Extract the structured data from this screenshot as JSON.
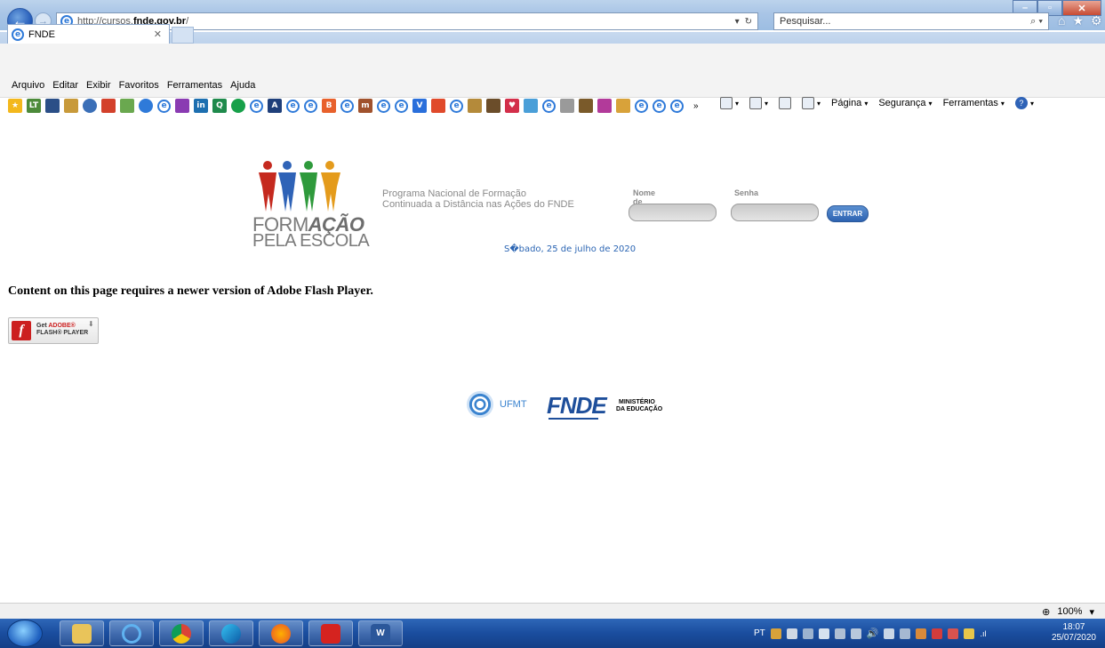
{
  "browser": {
    "url_prefix": "http://cursos.",
    "url_domain": "fnde.gov.br",
    "url_suffix": "/",
    "search_placeholder": "Pesquisar...",
    "tab_title": "FNDE",
    "menu": [
      "Arquivo",
      "Editar",
      "Exibir",
      "Favoritos",
      "Ferramentas",
      "Ajuda"
    ],
    "commands": {
      "page": "Página",
      "security": "Segurança",
      "tools": "Ferramentas"
    },
    "zoom": "100%"
  },
  "header": {
    "brand_line1_a": "FORM",
    "brand_line1_b": "AÇÃO",
    "brand_line2": "PELA ESCOLA",
    "program_line1": "Programa Nacional de Formação",
    "program_line2": "Continuada a Distância nas Ações do FNDE",
    "username_label": "Nome de usuário",
    "password_label": "Senha",
    "login_button": "ENTRAR",
    "date": "S�bado, 25 de julho de 2020"
  },
  "content": {
    "flash_message": "Content on this page requires a newer version of Adobe Flash Player.",
    "flash_badge_get": "Get",
    "flash_badge_adobe": "ADOBE®",
    "flash_badge_player": "FLASH® PLAYER"
  },
  "footer": {
    "ufmt": "UFMT",
    "fnde": "FNDE",
    "ministerio_line1": "MINISTÉRIO",
    "ministerio_line2": "DA EDUCAÇÃO"
  },
  "taskbar": {
    "language": "PT",
    "time": "18:07",
    "date": "25/07/2020"
  }
}
